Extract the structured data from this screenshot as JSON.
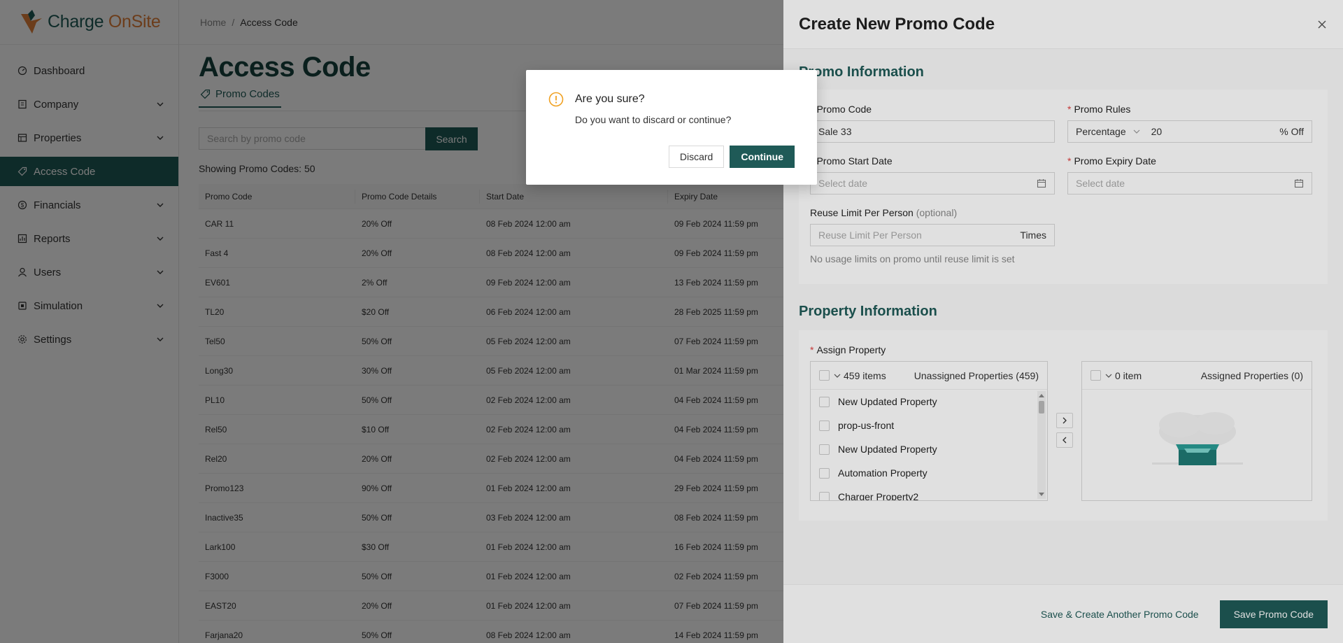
{
  "brand": {
    "charge": "Charge",
    "onsite": "OnSite"
  },
  "breadcrumb": {
    "home": "Home",
    "sep": "/",
    "current": "Access Code"
  },
  "sidebar": {
    "items": [
      {
        "label": "Dashboard",
        "icon": "dashboard-icon",
        "has_children": false
      },
      {
        "label": "Company",
        "icon": "building-icon",
        "has_children": true
      },
      {
        "label": "Properties",
        "icon": "properties-icon",
        "has_children": true
      },
      {
        "label": "Access Code",
        "icon": "tag-icon",
        "has_children": false,
        "active": true
      },
      {
        "label": "Financials",
        "icon": "dollar-icon",
        "has_children": true
      },
      {
        "label": "Reports",
        "icon": "report-icon",
        "has_children": true
      },
      {
        "label": "Users",
        "icon": "user-icon",
        "has_children": true
      },
      {
        "label": "Simulation",
        "icon": "simulation-icon",
        "has_children": true
      },
      {
        "label": "Settings",
        "icon": "gear-icon",
        "has_children": true
      }
    ]
  },
  "page": {
    "title": "Access Code",
    "tab": "Promo Codes",
    "search_placeholder": "Search by promo code",
    "search_button": "Search",
    "showing": "Showing Promo Codes: 50"
  },
  "table": {
    "headers": [
      "Promo Code",
      "Promo Code Details",
      "Start Date",
      "Expiry Date"
    ],
    "rows": [
      [
        "CAR 11",
        "20% Off",
        "08 Feb 2024 12:00 am",
        "09 Feb 2024 11:59 pm"
      ],
      [
        "Fast 4",
        "20% Off",
        "08 Feb 2024 12:00 am",
        "09 Feb 2024 11:59 pm"
      ],
      [
        "EV601",
        "2% Off",
        "09 Feb 2024 12:00 am",
        "13 Feb 2024 11:59 pm"
      ],
      [
        "TL20",
        "$20 Off",
        "06 Feb 2024 12:00 am",
        "28 Feb 2025 11:59 pm"
      ],
      [
        "Tel50",
        "50% Off",
        "05 Feb 2024 12:00 am",
        "07 Feb 2024 11:59 pm"
      ],
      [
        "Long30",
        "30% Off",
        "05 Feb 2024 12:00 am",
        "01 Mar 2024 11:59 pm"
      ],
      [
        "PL10",
        "50% Off",
        "02 Feb 2024 12:00 am",
        "04 Feb 2024 11:59 pm"
      ],
      [
        "Rel50",
        "$10 Off",
        "02 Feb 2024 12:00 am",
        "04 Feb 2024 11:59 pm"
      ],
      [
        "Rel20",
        "20% Off",
        "02 Feb 2024 12:00 am",
        "04 Feb 2024 11:59 pm"
      ],
      [
        "Promo123",
        "90% Off",
        "01 Feb 2024 12:00 am",
        "29 Feb 2024 11:59 pm"
      ],
      [
        "Inactive35",
        "50% Off",
        "03 Feb 2024 12:00 am",
        "08 Feb 2024 11:59 pm"
      ],
      [
        "Lark100",
        "$30 Off",
        "01 Feb 2024 12:00 am",
        "16 Feb 2024 11:59 pm"
      ],
      [
        "F3000",
        "50% Off",
        "01 Feb 2024 12:00 am",
        "02 Feb 2024 11:59 pm"
      ],
      [
        "EAST20",
        "20% Off",
        "01 Feb 2024 12:00 am",
        "07 Feb 2024 11:59 pm"
      ],
      [
        "Farjana20",
        "50% Off",
        "08 Feb 2024 12:00 am",
        "14 Feb 2024 11:59 pm"
      ]
    ]
  },
  "drawer": {
    "title": "Create New Promo Code",
    "promo_section": "Promo Information",
    "promo_code_label": "Promo Code",
    "promo_code_value": "Sale 33",
    "promo_rules_label": "Promo Rules",
    "promo_rules_type": "Percentage",
    "promo_rules_value": "20",
    "promo_rules_suffix": "% Off",
    "start_date_label": "Promo Start Date",
    "start_date_placeholder": "Select date",
    "expiry_date_label": "Promo Expiry Date",
    "expiry_date_placeholder": "Select date",
    "reuse_label": "Reuse Limit Per Person",
    "reuse_optional": "(optional)",
    "reuse_placeholder": "Reuse Limit Per Person",
    "reuse_suffix": "Times",
    "reuse_hint": "No usage limits on promo until reuse limit is set",
    "property_section": "Property Information",
    "assign_label": "Assign Property",
    "left_list": {
      "count": "459 items",
      "title": "Unassigned Properties (459)",
      "items": [
        "New Updated Property",
        "prop-us-front",
        "New Updated Property",
        "Automation Property",
        "Charger Property2"
      ]
    },
    "right_list": {
      "count": "0 item",
      "title": "Assigned Properties (0)"
    },
    "save_another": "Save & Create Another Promo Code",
    "save": "Save Promo Code"
  },
  "modal": {
    "title": "Are you sure?",
    "text": "Do you want to discard or continue?",
    "discard": "Discard",
    "continue": "Continue"
  },
  "colors": {
    "primary": "#1f5a57",
    "brand_orange": "#e2803a",
    "warning": "#f0a020"
  }
}
